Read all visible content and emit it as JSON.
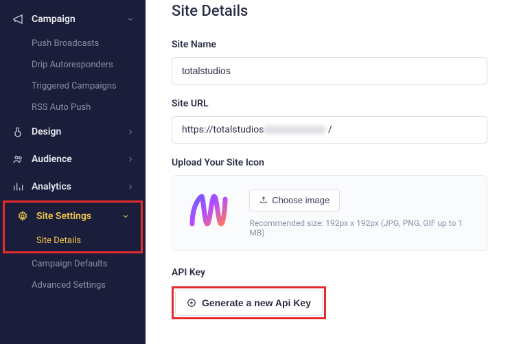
{
  "sidebar": {
    "campaign": {
      "label": "Campaign"
    },
    "campaign_subs": [
      "Push Broadcasts",
      "Drip Autoresponders",
      "Triggered Campaigns",
      "RSS Auto Push"
    ],
    "design": {
      "label": "Design"
    },
    "audience": {
      "label": "Audience"
    },
    "analytics": {
      "label": "Analytics"
    },
    "site_settings": {
      "label": "Site Settings"
    },
    "site_settings_subs": [
      "Site Details",
      "Campaign Defaults",
      "Advanced Settings"
    ]
  },
  "page": {
    "title": "Site Details",
    "site_name_label": "Site Name",
    "site_name_value": "totalstudios",
    "site_url_label": "Site URL",
    "site_url_value_prefix": "https://totalstudios",
    "site_url_value_suffix": " /",
    "upload_label": "Upload Your Site Icon",
    "choose_image": "Choose image",
    "recommend": "Recommended size: 192px x 192px (JPG, PNG, GIF up to 1 MB)",
    "api_key_label": "API Key",
    "generate": "Generate a new Api Key"
  }
}
